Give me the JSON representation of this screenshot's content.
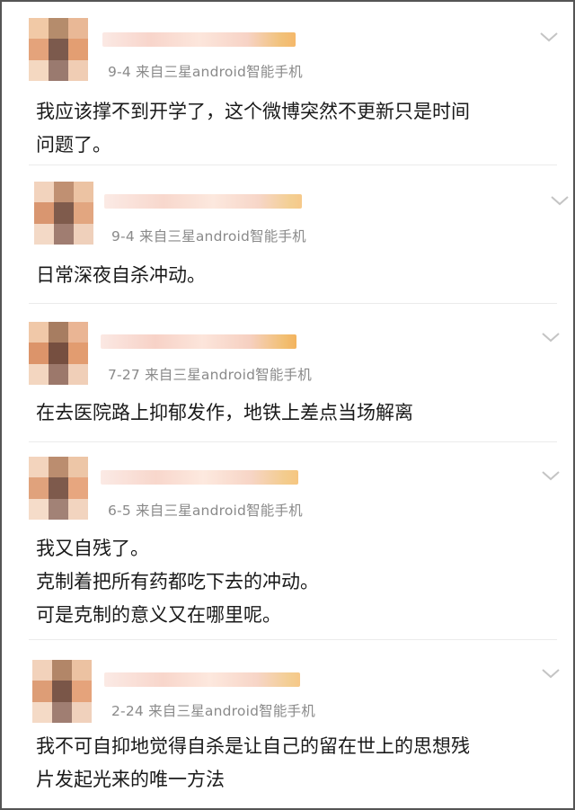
{
  "posts": [
    {
      "meta": "9-4  来自三星android智能手机",
      "lines": [
        "我应该撑不到开学了，这个微博突然不更新只是时间",
        "问题了。"
      ]
    },
    {
      "meta": "9-4  来自三星android智能手机",
      "lines": [
        "日常深夜自杀冲动。"
      ]
    },
    {
      "meta": "7-27  来自三星android智能手机",
      "lines": [
        "在去医院路上抑郁发作，地铁上差点当场解离"
      ]
    },
    {
      "meta": "6-5  来自三星android智能手机",
      "lines": [
        "我又自残了。",
        "克制着把所有药都吃下去的冲动。",
        "可是克制的意义又在哪里呢。"
      ]
    },
    {
      "meta": "2-24  来自三星android智能手机",
      "lines": [
        "我不可自抑地觉得自杀是让自己的留在世上的思想残",
        "片发起光来的唯一方法"
      ]
    }
  ],
  "icons": {
    "expand": "chevron-down-icon",
    "avatar": "blurred-avatar",
    "username": "blurred-username"
  },
  "colors": {
    "meta_text": "#8a8a8a",
    "body_text": "#1a1a1a",
    "divider": "#ebebeb",
    "chevron": "#c4c4c4"
  }
}
